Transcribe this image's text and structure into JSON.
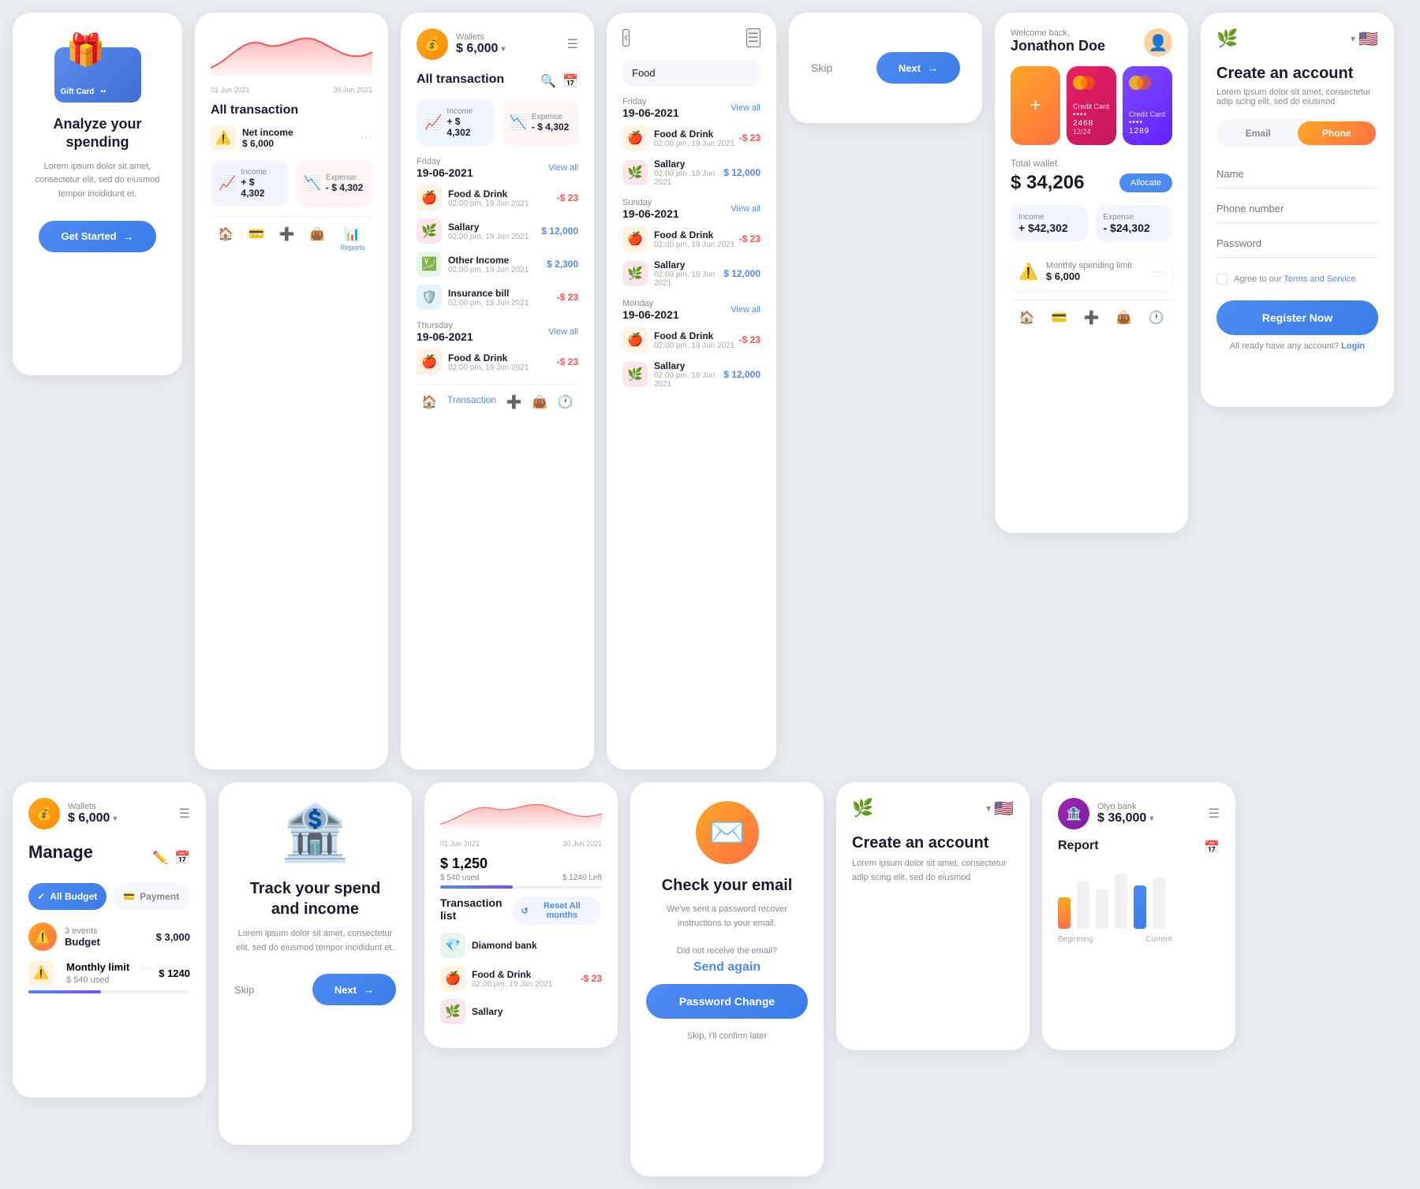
{
  "panels": {
    "gift": {
      "title": "Analyze your spending",
      "desc": "Lorem ipsum dolor sit amet, consectetur elit, sed do eiusmod tempor incididunt et.",
      "btn_label": "Get Started",
      "card_label": "Gift Card"
    },
    "transactions": {
      "wallet_label": "Wallets",
      "wallet_amount": "$ 6,000",
      "section_title": "All transaction",
      "income_label": "Income",
      "income_value": "+ $ 4,302",
      "expense_label": "Expense",
      "expense_value": "- $ 4,302",
      "friday_label": "Friday",
      "friday_date": "19-06-2021",
      "view_all": "View all",
      "thursday_label": "Thursday",
      "thursday_date": "19-06-2021",
      "txn_list": [
        {
          "name": "Food & Drink",
          "date": "02:00 pm, 19 Jun 2021",
          "amount": "-$ 23",
          "type": "neg"
        },
        {
          "name": "Sallary",
          "date": "02:00 pm, 19 Jun 2021",
          "amount": "$ 12,000",
          "type": "pos"
        },
        {
          "name": "Other Income",
          "date": "02:00 pm, 19 Jun 2021",
          "amount": "$ 2,300",
          "type": "pos"
        },
        {
          "name": "Insurance bill",
          "date": "02:00 pm, 19 Jun 2021",
          "amount": "-$ 23",
          "type": "neg"
        }
      ],
      "thu_txn_list": [
        {
          "name": "Food & Drink",
          "date": "02:00 pm, 19 Jun 2021",
          "amount": "-$ 23",
          "type": "neg"
        }
      ],
      "net_income_label": "Net income",
      "net_income_value": "$ 6,000",
      "income_stat_label": "Income",
      "income_stat_value": "+ $ 4,302",
      "expense_stat_label": "Expense",
      "expense_stat_value": "- $ 4,302"
    },
    "filter": {
      "search_placeholder": "Food",
      "friday_label": "Friday",
      "friday_date": "19-06-2021",
      "view_all": "View all",
      "sunday_label": "Sunday",
      "sunday_date": "19-06-2021",
      "monday_label": "Monday",
      "monday_date": "19-06-2021",
      "filter_txns": [
        {
          "name": "Food & Drink",
          "date": "02:00 pm, 19 Jun 2021",
          "amount": "-$ 23",
          "type": "neg"
        },
        {
          "name": "Sallary",
          "date": "02:00 pm, 19 Jun 2021",
          "amount": "$ 12,000",
          "type": "pos"
        },
        {
          "name": "Food & Drink",
          "date": "02:00 pm, 19 Jun 2021",
          "amount": "-$ 23",
          "type": "neg"
        },
        {
          "name": "Sallary",
          "date": "02:00 pm, 19 Jun 2021",
          "amount": "$ 12,000",
          "type": "pos"
        },
        {
          "name": "Food & Drink",
          "date": "02:00 pm, 19 Jun 2021",
          "amount": "-$ 23",
          "type": "neg"
        },
        {
          "name": "Sallary",
          "date": "02:00 pm, 19 Jun 2021",
          "amount": "$ 12,000",
          "type": "pos"
        }
      ]
    },
    "wallet_main": {
      "welcome_text": "Welcome back,",
      "user_name": "Jonathon Doe",
      "card1_label": "Credit Card",
      "card1_number": "•••• 2468",
      "card1_expiry": "12/24",
      "card2_label": "Credit Card",
      "card2_number": "•••• 1289",
      "total_label": "Total wallet",
      "total_amount": "$ 34,206",
      "allocate_label": "Allocate",
      "income_label": "Income",
      "income_value": "+ $42,302",
      "expense_label": "Expense",
      "expense_value": "- $24,302",
      "spending_label": "Monthly spending limit",
      "spending_amount": "$ 6,000",
      "nav_items": [
        "home",
        "card",
        "add",
        "wallet",
        "clock"
      ]
    },
    "register": {
      "title": "Create an account",
      "desc": "Lorem ipsum dolor sit amet, consectetur adip scing elit, sed do eiusmod",
      "tab_email": "Email",
      "tab_phone": "Phone",
      "field_name": "Name",
      "field_phone": "Phone number",
      "field_password": "Password",
      "terms_text": "Agree to our ",
      "terms_link": "Terms and Service",
      "register_btn": "Register Now",
      "login_text": "All ready have any account?",
      "login_link": "Login"
    },
    "onboard": {
      "skip_label": "Skip",
      "next_label": "Next"
    },
    "manage": {
      "wallet_label": "Wallets",
      "wallet_amount": "$ 6,000",
      "title": "Manage",
      "tab_budget": "All Budget",
      "tab_payment": "Payment",
      "budget_label": "3 events",
      "budget_sublabel": "Budget",
      "budget_amount": "$ 3,000",
      "monthly_label": "Monthly limit",
      "monthly_used": "$ 540 used",
      "monthly_total": "$ 1240"
    },
    "track": {
      "title": "Track your spend and income",
      "desc": "Lorem ipsum dolor sit amet, consectetur elit, sed do eiusmod tempor incididunt et.",
      "skip_label": "Skip",
      "next_label": "Next"
    },
    "email_check": {
      "title": "Check your email",
      "desc": "We've sent a password recover instructions to your email.",
      "resend_text": "Did not receive the email?",
      "send_again": "Send again",
      "pwd_change_btn": "Password Change",
      "skip_label": "Skip, I'll confirm later"
    },
    "register2": {
      "brand_label": "🌿",
      "title": "Create an account",
      "desc": "Lorem ipsum dolor sit amet, consectetur adip scing elit, sed do eiusmod"
    },
    "extra_chart": {
      "date_start": "01 Jun 2021",
      "date_end": "30 Jun 2021",
      "amount": "$ 1,250",
      "used": "$ 540 used",
      "left": "$ 1240 Left",
      "txn_title": "Transaction list",
      "diamond_bank": "Diamond bank",
      "reset_all": "Reset All months",
      "txns": [
        {
          "name": "Food & Drink",
          "date": "02:00 pm, 19 Jun 2021",
          "amount": "-$ 23",
          "type": "neg"
        },
        {
          "name": "Sallary",
          "date": "",
          "amount": "",
          "type": "pos"
        }
      ]
    }
  }
}
